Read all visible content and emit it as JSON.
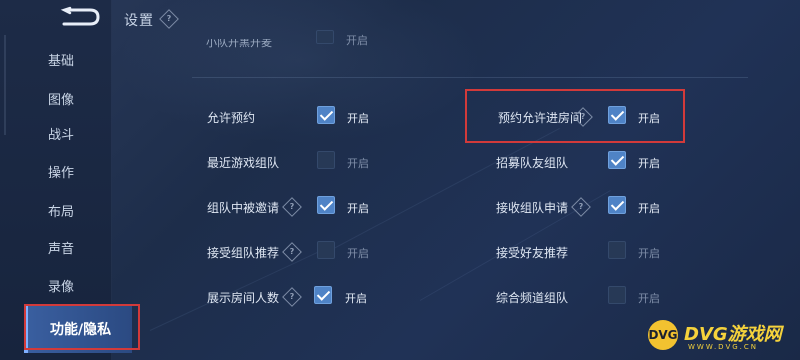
{
  "header": {
    "title": "设置"
  },
  "sidebar": {
    "items": [
      {
        "label": "基础"
      },
      {
        "label": "图像"
      },
      {
        "label": "战斗"
      },
      {
        "label": "操作"
      },
      {
        "label": "布局"
      },
      {
        "label": "声音"
      },
      {
        "label": "录像"
      },
      {
        "label": "功能/隐私",
        "active": true
      }
    ]
  },
  "top_row": {
    "label": "小队开黑开麦",
    "state": "开启",
    "checked": false
  },
  "settings": {
    "left": [
      {
        "label": "允许预约",
        "help": false,
        "checked": true,
        "state": "开启"
      },
      {
        "label": "最近游戏组队",
        "help": false,
        "checked": false,
        "state": "开启"
      },
      {
        "label": "组队中被邀请",
        "help": true,
        "checked": true,
        "state": "开启"
      },
      {
        "label": "接受组队推荐",
        "help": true,
        "checked": false,
        "state": "开启"
      },
      {
        "label": "展示房间人数",
        "help": true,
        "checked": true,
        "state": "开启"
      }
    ],
    "right": [
      {
        "label": "预约允许进房间",
        "help": true,
        "checked": true,
        "state": "开启"
      },
      {
        "label": "招募队友组队",
        "help": false,
        "checked": true,
        "state": "开启"
      },
      {
        "label": "接收组队申请",
        "help": true,
        "checked": true,
        "state": "开启"
      },
      {
        "label": "接受好友推荐",
        "help": false,
        "checked": false,
        "state": "开启"
      },
      {
        "label": "综合频道组队",
        "help": false,
        "checked": false,
        "state": "开启"
      }
    ]
  },
  "watermark": {
    "text": "DVG游戏网",
    "sub": "WWW.DVG.CN",
    "logo": "DVG"
  },
  "colors": {
    "accent": "#4f83c6",
    "highlight": "#d23a3a",
    "background": "#1b2a45"
  }
}
